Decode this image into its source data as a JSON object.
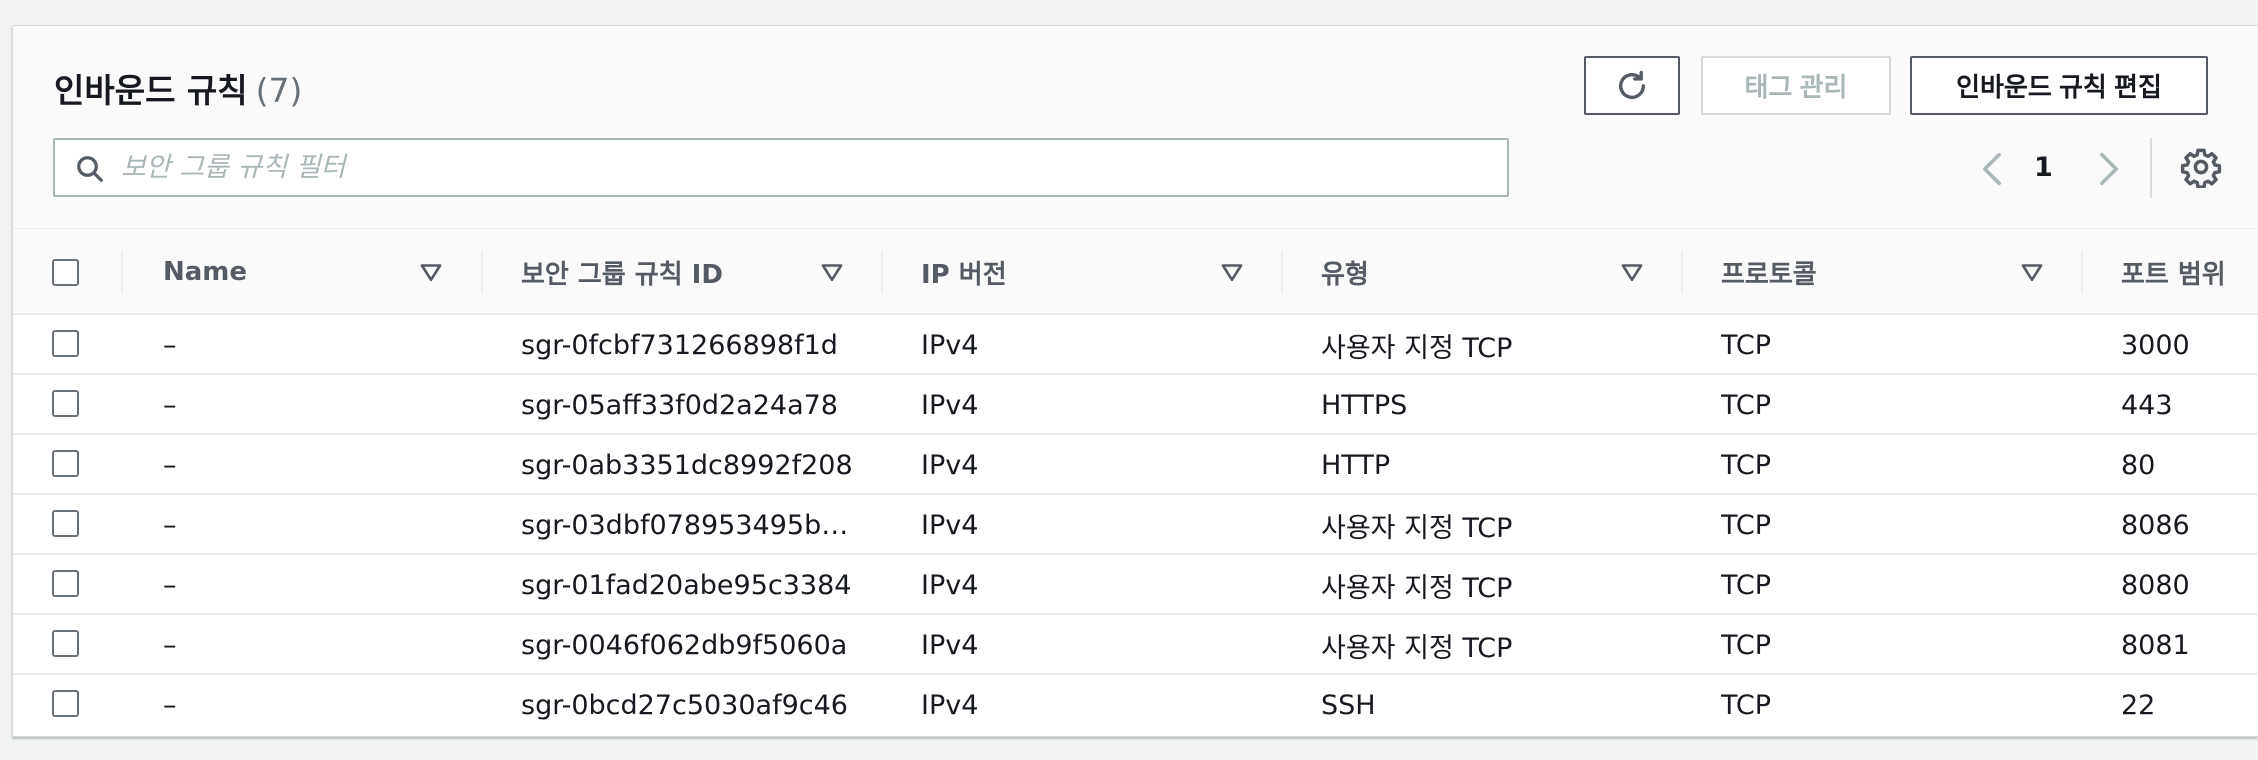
{
  "header": {
    "title": "인바운드 규칙",
    "count": "(7)",
    "manage_tags_label": "태그 관리",
    "edit_rules_label": "인바운드 규칙 편집"
  },
  "search": {
    "placeholder": "보안 그룹 규칙 필터",
    "value": ""
  },
  "pagination": {
    "current_page": "1"
  },
  "table": {
    "columns": [
      {
        "key": "name",
        "label": "Name"
      },
      {
        "key": "rule_id",
        "label": "보안 그룹 규칙 ID"
      },
      {
        "key": "ip_version",
        "label": "IP 버전"
      },
      {
        "key": "type",
        "label": "유형"
      },
      {
        "key": "protocol",
        "label": "프로토콜"
      },
      {
        "key": "port_range",
        "label": "포트 범위"
      }
    ],
    "rows": [
      {
        "name": "–",
        "rule_id": "sgr-0fcbf731266898f1d",
        "ip_version": "IPv4",
        "type": "사용자 지정 TCP",
        "protocol": "TCP",
        "port_range": "3000"
      },
      {
        "name": "–",
        "rule_id": "sgr-05aff33f0d2a24a78",
        "ip_version": "IPv4",
        "type": "HTTPS",
        "protocol": "TCP",
        "port_range": "443"
      },
      {
        "name": "–",
        "rule_id": "sgr-0ab3351dc8992f208",
        "ip_version": "IPv4",
        "type": "HTTP",
        "protocol": "TCP",
        "port_range": "80"
      },
      {
        "name": "–",
        "rule_id": "sgr-03dbf078953495b…",
        "ip_version": "IPv4",
        "type": "사용자 지정 TCP",
        "protocol": "TCP",
        "port_range": "8086"
      },
      {
        "name": "–",
        "rule_id": "sgr-01fad20abe95c3384",
        "ip_version": "IPv4",
        "type": "사용자 지정 TCP",
        "protocol": "TCP",
        "port_range": "8080"
      },
      {
        "name": "–",
        "rule_id": "sgr-0046f062db9f5060a",
        "ip_version": "IPv4",
        "type": "사용자 지정 TCP",
        "protocol": "TCP",
        "port_range": "8081"
      },
      {
        "name": "–",
        "rule_id": "sgr-0bcd27c5030af9c46",
        "ip_version": "IPv4",
        "type": "SSH",
        "protocol": "TCP",
        "port_range": "22"
      }
    ]
  },
  "icons": {
    "refresh": "refresh-icon",
    "search": "search-icon",
    "prev": "chevron-left-icon",
    "next": "chevron-right-icon",
    "settings": "gear-icon",
    "sort": "caret-down-icon"
  },
  "colors": {
    "text": "#16191f",
    "muted": "#687078",
    "border": "#eaeded",
    "disabled": "#aab7b8"
  }
}
